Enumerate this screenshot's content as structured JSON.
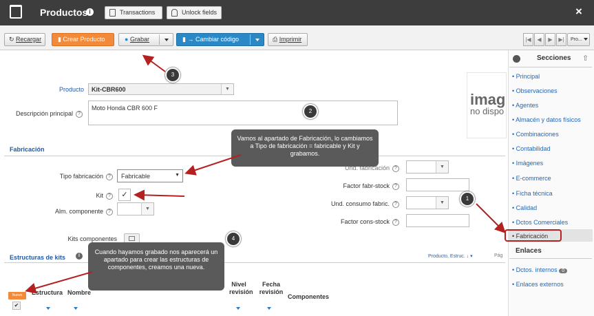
{
  "app": {
    "title": "Productos",
    "transactions": "Transactions",
    "unlock": "Unlock fields",
    "close": "×"
  },
  "toolbar": {
    "recargar": "Recargar",
    "crear": "Crear Producto",
    "grabar": "Grabar",
    "cambiar": "Cambiar código",
    "imprimir": "Imprimir",
    "pro": "Pro..."
  },
  "form": {
    "producto_label": "Producto",
    "producto_value": "Kit-CBR600",
    "desc_label": "Descripción principal",
    "desc_value": "Moto Honda CBR 600 F",
    "fabricacion_title": "Fabricación",
    "tipo_label": "Tipo fabricación",
    "tipo_value": "Fabricable",
    "kit_label": "Kit",
    "kit_check": "✓",
    "alm_label": "Alm. componente",
    "kits_comp_label": "Kits componentes",
    "und_fab_label": "Und. fabricación",
    "factor_fabr_label": "Factor fabr-stock",
    "und_cons_label": "Und. consumo fabric.",
    "factor_cons_label": "Factor cons-stock",
    "image_text_1": "imag",
    "image_text_2": "no dispo"
  },
  "estructuras": {
    "title": "Estructuras de kits",
    "sort_label": "Producto, Estruc.",
    "pag": "Pág",
    "nuevo": "Nuevo",
    "cols": {
      "estructura": "Estructura",
      "nombre": "Nombre",
      "nivel": "Nivel",
      "nivel2": "revisión",
      "fecha": "Fecha",
      "fecha2": "revisión",
      "componentes": "Componentes"
    }
  },
  "sidebar": {
    "secciones": "Secciones",
    "items": [
      "Principal",
      "Observaciones",
      "Agentes",
      "Almacén y datos físicos",
      "Combinaciones",
      "Contabilidad",
      "Imágenes",
      "E-commerce",
      "Ficha técnica",
      "Calidad",
      "Dctos Comerciales",
      "Fabricación"
    ],
    "enlaces": "Enlaces",
    "enlaces_items": [
      "Dctos. internos",
      "Enlaces externos"
    ],
    "badge": "0"
  },
  "callouts": {
    "c1": "1",
    "c2": "2",
    "c3": "3",
    "c4": "4",
    "text2": "Vamos al apartado de Fabricación, lo cambiamos a Tipo de fabricación = fabricable y Kit y grabamos.",
    "text4": "Cuando hayamos grabado nos aparecerá un apartado para crear las estructuras de componentes, creamos una nueva."
  },
  "colors": {
    "accent_orange": "#f28a3c",
    "accent_blue": "#2b88c6",
    "highlight_red": "#b52020"
  }
}
